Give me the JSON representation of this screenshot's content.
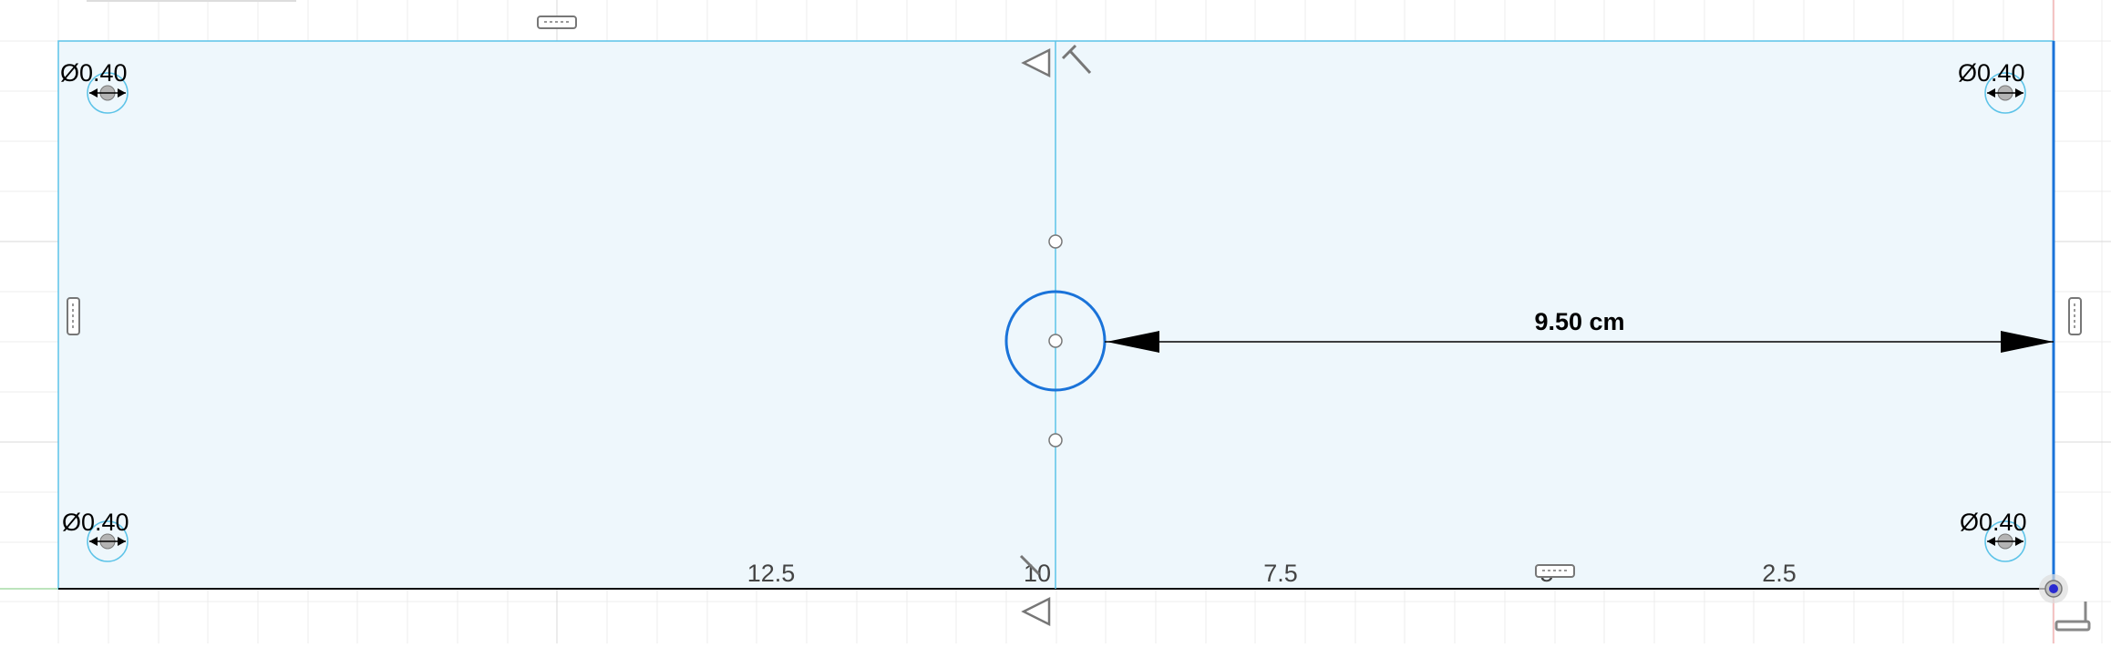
{
  "sketch": {
    "dimension_label": "9.50 cm",
    "hole_labels": [
      "Ø0.40",
      "Ø0.40",
      "Ø0.40",
      "Ø0.40"
    ],
    "ruler_ticks": [
      "12.5",
      "10",
      "7.5",
      "5",
      "2.5"
    ]
  },
  "colors": {
    "profile_fill": "#eef7fc",
    "sketch_line": "#5cc3e8",
    "selected": "#1a73d9",
    "grid": "#e8e8e8",
    "dimension": "#000000"
  },
  "icons": [
    "horizontal-constraint-icon",
    "vertical-constraint-icon",
    "midpoint-constraint-icon",
    "perpendicular-constraint-icon",
    "origin-point-icon",
    "axis-indicator-icon"
  ]
}
